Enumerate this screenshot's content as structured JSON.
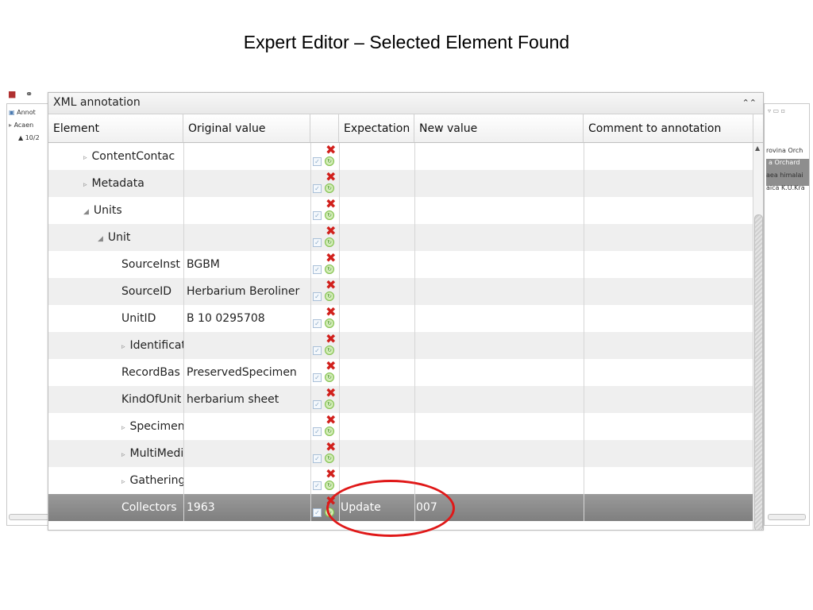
{
  "slide": {
    "title": "Expert Editor – Selected Element Found"
  },
  "background_left": {
    "items": [
      "Annot",
      "Acaen",
      "10/2"
    ]
  },
  "background_right": {
    "items": [
      "rovina Orch",
      "a Orchard",
      "aea himalai",
      "aica K.U.Kra"
    ]
  },
  "dialog": {
    "title": "XML annotation",
    "columns": [
      "Element",
      "Original value",
      "",
      "Expectation",
      "New value",
      "Comment to annotation"
    ],
    "rows": [
      {
        "element": "ContentContac",
        "indent": 1,
        "arrow": "right",
        "original": "",
        "expectation": "",
        "new_value": "",
        "comment": ""
      },
      {
        "element": "Metadata",
        "indent": 1,
        "arrow": "right",
        "original": "",
        "expectation": "",
        "new_value": "",
        "comment": ""
      },
      {
        "element": "Units",
        "indent": 1,
        "arrow": "down",
        "original": "",
        "expectation": "",
        "new_value": "",
        "comment": ""
      },
      {
        "element": "Unit",
        "indent": 2,
        "arrow": "down",
        "original": "",
        "expectation": "",
        "new_value": "",
        "comment": ""
      },
      {
        "element": "SourceInst",
        "indent": 3,
        "arrow": "",
        "original": "BGBM",
        "expectation": "",
        "new_value": "",
        "comment": ""
      },
      {
        "element": "SourceID",
        "indent": 3,
        "arrow": "",
        "original": "Herbarium Beroliner",
        "expectation": "",
        "new_value": "",
        "comment": ""
      },
      {
        "element": "UnitID",
        "indent": 3,
        "arrow": "",
        "original": "B 10 0295708",
        "expectation": "",
        "new_value": "",
        "comment": ""
      },
      {
        "element": "Identificat",
        "indent": 3,
        "arrow": "right",
        "original": "",
        "expectation": "",
        "new_value": "",
        "comment": ""
      },
      {
        "element": "RecordBas",
        "indent": 3,
        "arrow": "",
        "original": "PreservedSpecimen",
        "expectation": "",
        "new_value": "",
        "comment": ""
      },
      {
        "element": "KindOfUnit",
        "indent": 3,
        "arrow": "",
        "original": "herbarium sheet",
        "expectation": "",
        "new_value": "",
        "comment": ""
      },
      {
        "element": "SpecimenU",
        "indent": 3,
        "arrow": "right",
        "original": "",
        "expectation": "",
        "new_value": "",
        "comment": ""
      },
      {
        "element": "MultiMedia",
        "indent": 3,
        "arrow": "right",
        "original": "",
        "expectation": "",
        "new_value": "",
        "comment": ""
      },
      {
        "element": "Gathering",
        "indent": 3,
        "arrow": "right",
        "original": "",
        "expectation": "",
        "new_value": "",
        "comment": ""
      },
      {
        "element": "Collectors",
        "indent": 3,
        "arrow": "",
        "original": "1963",
        "expectation": "Update",
        "new_value": "007",
        "comment": "",
        "selected": true
      }
    ]
  },
  "colors": {
    "highlight_oval": "#e01818",
    "reject_icon": "#d1201c",
    "accept_icon": "#7fbf4a",
    "selected_row": "#8c8c8c"
  },
  "icons": {
    "reject": "red-x-icon",
    "accept": "green-check-icon",
    "checkbox": "checkbox-icon",
    "collapse": "double-chevron-up-icon"
  }
}
